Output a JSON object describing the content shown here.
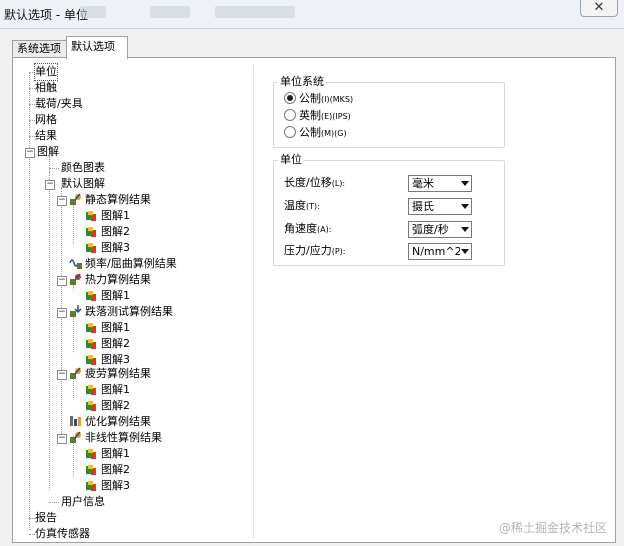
{
  "window": {
    "title": "默认选项 - 单位",
    "close_glyph": "✕"
  },
  "tabs": [
    {
      "label": "系统选项",
      "active": false
    },
    {
      "label": "默认选项",
      "active": true
    }
  ],
  "tree": {
    "items": [
      {
        "label": "单位",
        "selected": true
      },
      {
        "label": "相触"
      },
      {
        "label": "载荷/夹具"
      },
      {
        "label": "网格"
      },
      {
        "label": "结果"
      },
      {
        "label": "图解"
      },
      {
        "label": "颜色图表"
      },
      {
        "label": "默认图解"
      },
      {
        "label": "静态算例结果"
      },
      {
        "label": "图解1"
      },
      {
        "label": "图解2"
      },
      {
        "label": "图解3"
      },
      {
        "label": "频率/屈曲算例结果"
      },
      {
        "label": "热力算例结果"
      },
      {
        "label": "图解1"
      },
      {
        "label": "跌落测试算例结果"
      },
      {
        "label": "图解1"
      },
      {
        "label": "图解2"
      },
      {
        "label": "图解3"
      },
      {
        "label": "疲劳算例结果"
      },
      {
        "label": "图解1"
      },
      {
        "label": "图解2"
      },
      {
        "label": "优化算例结果"
      },
      {
        "label": "非线性算例结果"
      },
      {
        "label": "图解1"
      },
      {
        "label": "图解2"
      },
      {
        "label": "图解3"
      },
      {
        "label": "用户信息"
      },
      {
        "label": "报告"
      },
      {
        "label": "仿真传感器"
      }
    ]
  },
  "unit_system": {
    "title": "单位系统",
    "options": [
      {
        "label": "公制",
        "suffix": "(I)(MKS)",
        "checked": true
      },
      {
        "label": "英制",
        "suffix": "(E)(IPS)",
        "checked": false
      },
      {
        "label": "公制",
        "suffix": "(M)(G)",
        "checked": false
      }
    ]
  },
  "units": {
    "title": "单位",
    "rows": [
      {
        "label": "长度/位移",
        "suffix": "(L):",
        "value": "毫米"
      },
      {
        "label": "温度",
        "suffix": "(T):",
        "value": "摄氏"
      },
      {
        "label": "角速度",
        "suffix": "(A):",
        "value": "弧度/秒"
      },
      {
        "label": "压力/应力",
        "suffix": "(P):",
        "value": "N/mm^2(MPa)"
      }
    ]
  },
  "watermark": "@稀土掘金技术社区"
}
